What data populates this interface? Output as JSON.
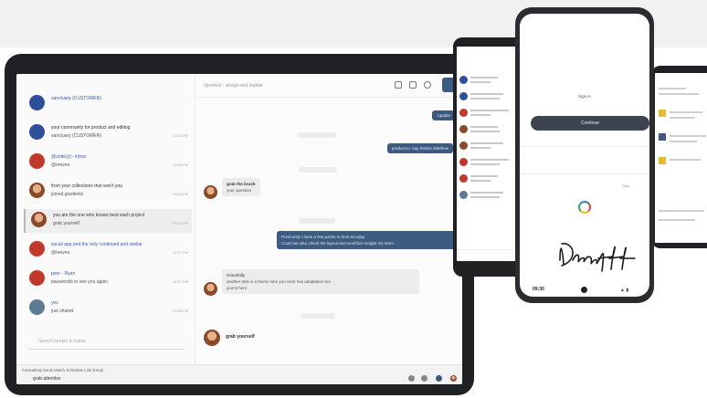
{
  "tablet": {
    "conversations": [
      {
        "name": "sanctuary (CUSTOMER)",
        "preview": "",
        "time": "",
        "avatar": "blue"
      },
      {
        "name": "your community for product and editing",
        "preview": "sanctuary (CUSTOMER)",
        "time": "10:09 PM",
        "avatar": "blue"
      },
      {
        "name": "@unite(z) - inbox",
        "preview": "@reeves",
        "time": "10:09 PM",
        "avatar": "red"
      },
      {
        "name": "from your collections that won't you",
        "preview": "joined gradients",
        "time": "10:08 PM",
        "avatar": "photo"
      },
      {
        "name": "you are the one who knows best each project",
        "preview": "grab yourself",
        "time": "10:08 PM",
        "avatar": "photo",
        "selected": true
      },
      {
        "name": "social app and the only continued and similar",
        "preview": "@reeves",
        "time": "10:07 PM",
        "avatar": "red"
      },
      {
        "name": "peer - Ryan",
        "preview": "passwords to see you again",
        "time": "10:07 PM",
        "avatar": "red"
      },
      {
        "name": "yes",
        "preview": "just shared",
        "time": "10:06 PM",
        "avatar": "grey"
      }
    ],
    "search_placeholder": "Search people & topics",
    "header_title": "#product - design and review",
    "messages": {
      "out1": "Update",
      "out2": "product.io: say thanks Matthew",
      "in1_sender": "grab the brush",
      "in1_text": "your question",
      "out3_line1": "Previously I have a few points to look at today",
      "out3_line2": "Could we also check the layout and workflow tonight my team",
      "in2_sender": "Gracefully",
      "in2_line1": "another task is a theme who you want has adaptation too",
      "in2_line2": "you're here",
      "last_sender": "grab yourself"
    },
    "compose_tabs": "Formatting   Send   Attach   Schedule   Link   Emoji",
    "compose_text": "grab attention"
  },
  "phone_front": {
    "label": "Sign in",
    "button": "Continue",
    "small_left": "",
    "small_right": "Skip",
    "status_time": "09:30"
  },
  "colors": {
    "navy": "#3d5a80",
    "dark_button": "#3d4450",
    "frame": "#1f2125"
  },
  "icons": [
    "search-icon",
    "phone-icon",
    "more-icon",
    "video-icon",
    "emoji-icon",
    "attach-icon",
    "send-icon",
    "spinner-icon",
    "signature-image"
  ]
}
